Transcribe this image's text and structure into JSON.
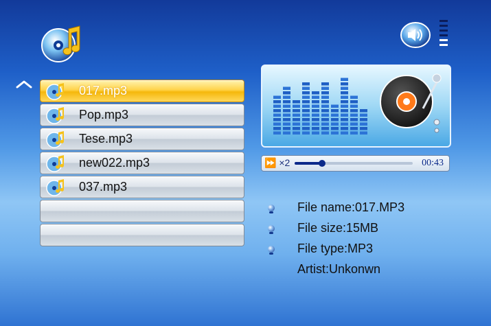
{
  "header": {
    "music_icon": "music-note-icon",
    "speaker_icon": "speaker-icon",
    "volume_level": 2,
    "volume_max": 6
  },
  "playlist": {
    "scroll_icon": "scroll-up-icon",
    "items": [
      {
        "label": "017.mp3",
        "selected": true
      },
      {
        "label": "Pop.mp3",
        "selected": false
      },
      {
        "label": "Tese.mp3",
        "selected": false
      },
      {
        "label": "new022.mp3",
        "selected": false
      },
      {
        "label": "037.mp3",
        "selected": false
      },
      {
        "label": "",
        "selected": false
      },
      {
        "label": "",
        "selected": false
      }
    ]
  },
  "player": {
    "visualizer_icon": "equalizer-disc-icon",
    "speed_label": "⏩ ×2",
    "progress": 0.23,
    "time": "00:43"
  },
  "info": {
    "lines": [
      {
        "text": "File name:017.MP3",
        "bullet": true
      },
      {
        "text": "File size:15MB",
        "bullet": true
      },
      {
        "text": "File type:MP3",
        "bullet": true
      },
      {
        "text": "Artist:Unkonwn",
        "bullet": false
      }
    ]
  },
  "colors": {
    "accent": "#0b2a8a",
    "selected": "#f5b80b"
  }
}
